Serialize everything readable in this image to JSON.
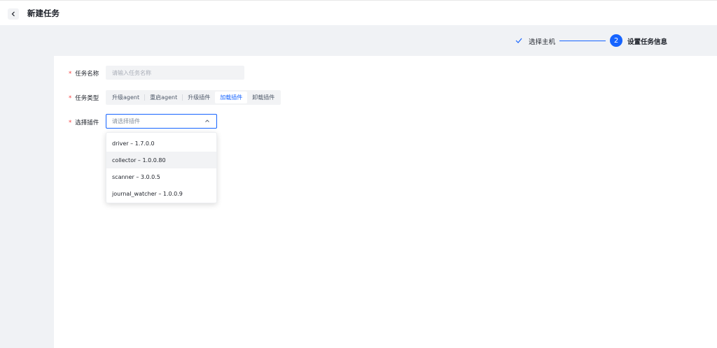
{
  "header": {
    "title": "新建任务"
  },
  "steps": [
    {
      "label": "选择主机",
      "status": "done"
    },
    {
      "number": "2",
      "label": "设置任务信息",
      "status": "active"
    }
  ],
  "form": {
    "task_name": {
      "label": "任务名称",
      "placeholder": "请输入任务名称"
    },
    "task_type": {
      "label": "任务类型",
      "options": [
        "升级agent",
        "重启agent",
        "升级插件",
        "加载插件",
        "卸载插件"
      ],
      "selected": "加载插件"
    },
    "plugin": {
      "label": "选择插件",
      "placeholder": "请选择插件",
      "options": [
        "driver – 1.7.0.0",
        "collector – 1.0.0.80",
        "scanner – 3.0.0.5",
        "journal_watcher – 1.0.0.9"
      ],
      "hovered": "collector – 1.0.0.80"
    },
    "required_mark": "*"
  },
  "colors": {
    "primary": "#1664ff",
    "required": "#f53f3f",
    "background": "#f0f2f5"
  },
  "icons": [
    "chevron-left-icon",
    "check-icon",
    "chevron-up-icon"
  ]
}
